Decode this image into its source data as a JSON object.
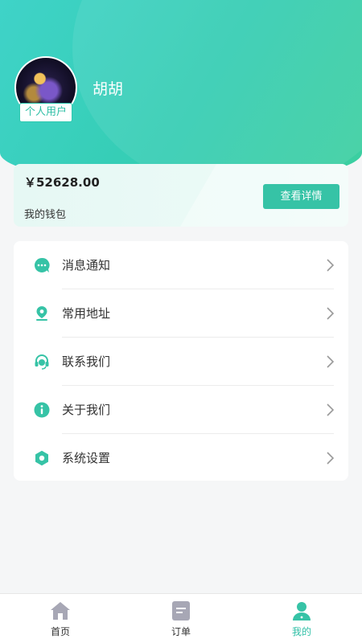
{
  "header": {
    "username": "胡胡",
    "user_type": "个人用户",
    "avatar_icon": "avatar-image"
  },
  "wallet": {
    "balance": "￥52628.00",
    "label": "我的钱包",
    "detail_button": "查看详情"
  },
  "menu": {
    "items": [
      {
        "label": "消息通知",
        "icon": "message-icon"
      },
      {
        "label": "常用地址",
        "icon": "location-icon"
      },
      {
        "label": "联系我们",
        "icon": "headset-icon"
      },
      {
        "label": "关于我们",
        "icon": "info-icon"
      },
      {
        "label": "系统设置",
        "icon": "settings-icon"
      }
    ]
  },
  "tabbar": {
    "tabs": [
      {
        "label": "首页",
        "icon": "home-icon",
        "active": false
      },
      {
        "label": "订单",
        "icon": "order-icon",
        "active": false
      },
      {
        "label": "我的",
        "icon": "profile-icon",
        "active": true
      }
    ]
  },
  "colors": {
    "accent": "#36c3a6",
    "header_start": "#3fd3c8",
    "header_end": "#3ccf9f",
    "tab_inactive_icon": "#a7a7b5"
  }
}
